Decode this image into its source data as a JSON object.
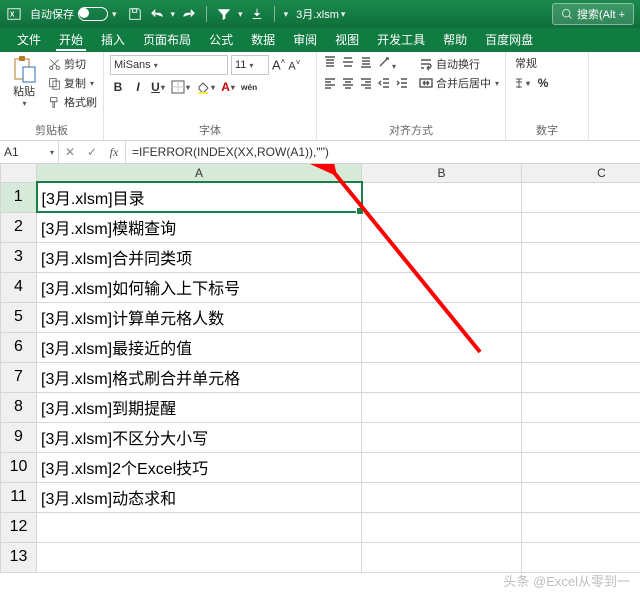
{
  "title": {
    "autosave_label": "自动保存",
    "filename": "3月.xlsm",
    "search_placeholder": "搜索(Alt +"
  },
  "tabs": [
    "文件",
    "开始",
    "插入",
    "页面布局",
    "公式",
    "数据",
    "审阅",
    "视图",
    "开发工具",
    "帮助",
    "百度网盘"
  ],
  "active_tab": 1,
  "clipboard": {
    "paste": "粘贴",
    "cut": "剪切",
    "copy": "复制",
    "format_painter": "格式刷",
    "group_label": "剪贴板"
  },
  "font": {
    "name": "MiSans",
    "size": "11",
    "grow": "A^",
    "shrink": "A˅",
    "group_label": "字体"
  },
  "align": {
    "wrap": "自动换行",
    "merge": "合并后居中",
    "group_label": "对齐方式"
  },
  "number": {
    "format": "常规",
    "group_label": "数字"
  },
  "namebox": "A1",
  "formula": "=IFERROR(INDEX(XX,ROW(A1)),\"\")",
  "columns": [
    "A",
    "B",
    "C"
  ],
  "rows": [
    {
      "n": "1",
      "a": "[3月.xlsm]目录"
    },
    {
      "n": "2",
      "a": "[3月.xlsm]模糊查询"
    },
    {
      "n": "3",
      "a": "[3月.xlsm]合并同类项"
    },
    {
      "n": "4",
      "a": "[3月.xlsm]如何输入上下标号"
    },
    {
      "n": "5",
      "a": "[3月.xlsm]计算单元格人数"
    },
    {
      "n": "6",
      "a": "[3月.xlsm]最接近的值"
    },
    {
      "n": "7",
      "a": "[3月.xlsm]格式刷合并单元格"
    },
    {
      "n": "8",
      "a": "[3月.xlsm]到期提醒"
    },
    {
      "n": "9",
      "a": "[3月.xlsm]不区分大小写"
    },
    {
      "n": "10",
      "a": "[3月.xlsm]2个Excel技巧"
    },
    {
      "n": "11",
      "a": "[3月.xlsm]动态求和"
    },
    {
      "n": "12",
      "a": ""
    },
    {
      "n": "13",
      "a": ""
    }
  ],
  "watermark": "头条 @Excel从零到一"
}
